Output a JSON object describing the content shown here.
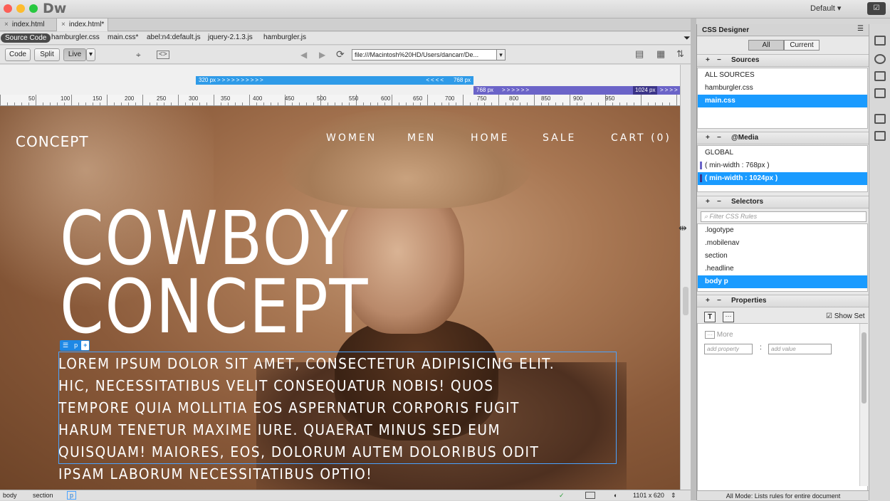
{
  "app": {
    "logo": "Dw",
    "workspace": "Default",
    "sync_icon": "sync-check-icon"
  },
  "doc_tabs": [
    {
      "label": "index.html",
      "active": false
    },
    {
      "label": "index.html*",
      "active": true
    }
  ],
  "related_files": {
    "source_code": "Source Code",
    "files": [
      "hamburgler.css",
      "main.css*",
      "abel:n4:default.js",
      "jquery-2.1.3.js",
      "hamburgler.js"
    ]
  },
  "toolbar": {
    "code": "Code",
    "split": "Split",
    "live": "Live",
    "address": "file:///Macintosh%20HD/Users/dancarr/De..."
  },
  "media_queries": {
    "bar1_left": "320",
    "bar1_right": "768",
    "bar2_left": "768",
    "bar2_right": "1024",
    "unit": "px"
  },
  "ruler": [
    "50",
    "100",
    "150",
    "200",
    "250",
    "300",
    "350",
    "400",
    "450",
    "500",
    "550",
    "600",
    "650",
    "700",
    "750",
    "800",
    "850",
    "900",
    "950"
  ],
  "site": {
    "logo": "CONCEPT",
    "nav": [
      "WOMEN",
      "MEN",
      "HOME",
      "SALE",
      "CART (0)"
    ],
    "headline_1": "COWBOY",
    "headline_2": "CONCEPT",
    "element_tag": "p",
    "paragraph": "Lorem ipsum dolor sit amet, consectetur adipisicing elit. Hic, necessitatibus velit consequatur nobis! Quos tempore quia mollitia eos aspernatur corporis fugit harum tenetur maxime iure. Quaerat minus sed eum quisquam! Maiores, eos, dolorum autem doloribus odit ipsam laborum necessitatibus optio!"
  },
  "statusbar": {
    "tags": [
      "body",
      "section",
      "p"
    ],
    "size": "1101 x 620"
  },
  "css_designer": {
    "title": "CSS Designer",
    "all": "All",
    "current": "Current",
    "sources": {
      "header": "Sources",
      "items": [
        "ALL SOURCES",
        "hamburgler.css",
        "main.css"
      ],
      "selected": 2
    },
    "media": {
      "header": "@Media",
      "items": [
        "GLOBAL",
        "( min-width : 768px )",
        "( min-width : 1024px )"
      ],
      "selected": 2
    },
    "selectors": {
      "header": "Selectors",
      "filter_placeholder": "Filter CSS Rules",
      "items": [
        ".logotype",
        ".mobilenav",
        "section",
        ".headline",
        "body p"
      ],
      "selected": 4
    },
    "properties": {
      "header": "Properties",
      "show_set": "Show Set",
      "more": "More",
      "add_property": "add property",
      "add_value": "add value"
    },
    "status": "All Mode: Lists rules for entire document"
  },
  "colors": {
    "accent": "#1a9bff",
    "mq_blue": "#2f9be8",
    "mq_purple": "#6b64c8"
  }
}
